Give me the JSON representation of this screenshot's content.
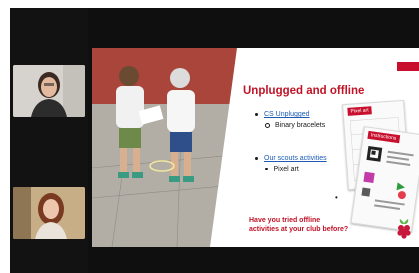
{
  "slide": {
    "heading": "Unplugged and offline",
    "bullets": [
      {
        "text": "CS Unplugged",
        "link": true
      },
      {
        "text": "Binary bracelets",
        "link": false
      },
      {
        "text": "Our scouts activities",
        "link": true
      },
      {
        "text": "Pixel art",
        "link": false
      }
    ],
    "question_line1": "Have you tried offline",
    "question_line2": "activities at your club before?",
    "worksheet_titles": [
      "Pixel art",
      "Instructions"
    ]
  },
  "colors": {
    "accent_red": "#c01326",
    "link_blue": "#1d5bb5",
    "meeting_bg": "#0f0f0f"
  },
  "icons": [
    "raspberry-pi-logo"
  ]
}
